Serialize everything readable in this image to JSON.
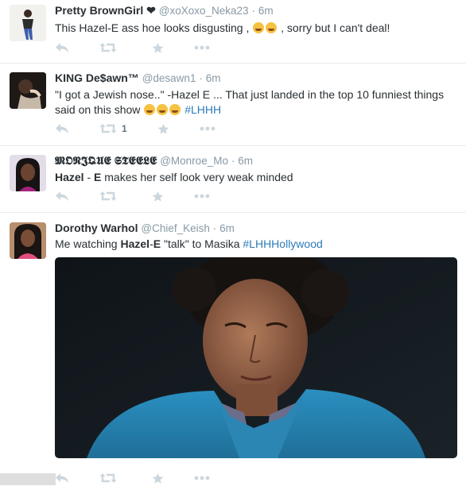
{
  "tweets": [
    {
      "name": "Pretty BrownGirl ❤",
      "handle": "@xoXoxo_Neka23",
      "time": "6m",
      "text_a": "This Hazel-E ass hoe looks disgusting ,",
      "text_b": ", sorry but I can't deal!",
      "retweet_count": ""
    },
    {
      "name": "KING De$awn™",
      "handle": "@desawn1",
      "time": "6m",
      "text_a": "\"I got a Jewish nose..\" -Hazel E ... That just landed in the top 10 funniest things said on this show",
      "hashtag": "#LHHH",
      "retweet_count": "1"
    },
    {
      "name": "𝕸𝕺𝕹𝕵𝕼𝖀𝕰 𝕾𝕿𝕰𝕰𝕷𝕰",
      "handle": "@Monroe_Mo",
      "time": "6m",
      "bold_a": "Hazel",
      "text_mid": " - ",
      "bold_b": "E",
      "text_a": " makes her self look very weak minded",
      "retweet_count": ""
    },
    {
      "name": "Dorothy Warhol",
      "handle": "@Chief_Keish",
      "time": "6m",
      "text_pre": "Me watching ",
      "bold_a": "Hazel",
      "text_mid": "-",
      "bold_b": "E",
      "text_a": " \"talk\" to Masika ",
      "hashtag": "#LHHHollywood",
      "retweet_count": ""
    }
  ],
  "separator_dot": "·",
  "icons": [
    "reply-icon",
    "retweet-icon",
    "favorite-icon",
    "more-icon"
  ],
  "colors": {
    "link": "#2b7bb9",
    "muted": "#8899a6",
    "icon": "#ccd6dd"
  }
}
